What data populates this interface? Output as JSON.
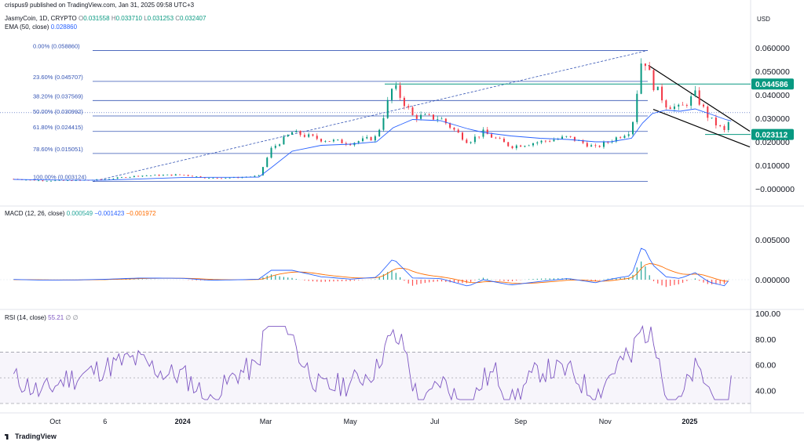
{
  "header": {
    "publisher": "crispus9 published on TradingView.com, Jan 31, 2025 09:58 UTC+3",
    "symbol": "JasmyCoin, 1D, CRYPTO",
    "open_label": "O",
    "open": "0.031558",
    "high_label": "H",
    "high": "0.033710",
    "low_label": "L",
    "low": "0.031253",
    "close_label": "C",
    "close": "0.032407",
    "ema_label": "EMA (50, close)",
    "ema_value": "0.028860",
    "currency": "USD"
  },
  "price_axis": {
    "ticks": [
      "0.060000",
      "0.050000",
      "0.040000",
      "0.030000",
      "0.020000",
      "0.010000",
      "−0.000000"
    ],
    "badges": [
      {
        "value": "0.044586",
        "color": "#089981"
      },
      {
        "value": "0.023112",
        "color": "#089981"
      }
    ]
  },
  "fib_levels": [
    {
      "label": "0.00% (0.058860)",
      "price": 0.05886
    },
    {
      "label": "23.60% (0.045707)",
      "price": 0.045707
    },
    {
      "label": "38.20% (0.037569)",
      "price": 0.037569
    },
    {
      "label": "50.00% (0.030992)",
      "price": 0.030992
    },
    {
      "label": "61.80% (0.024415)",
      "price": 0.024415
    },
    {
      "label": "78.60% (0.015051)",
      "price": 0.015051
    },
    {
      "label": "100.00% (0.003124)",
      "price": 0.003124
    }
  ],
  "macd": {
    "label": "MACD (12, 26, close)",
    "hist": "0.000549",
    "macd": "−0.001423",
    "signal": "−0.001972",
    "ticks": [
      "0.005000",
      "0.000000"
    ]
  },
  "rsi": {
    "label": "RSI (14, close)",
    "value": "55.21",
    "extra": "∅ ∅",
    "ticks": [
      "100.00",
      "80.00",
      "60.00",
      "40.00"
    ]
  },
  "x_axis": {
    "ticks": [
      {
        "label": "Oct",
        "bold": false
      },
      {
        "label": "6",
        "bold": false
      },
      {
        "label": "2024",
        "bold": true
      },
      {
        "label": "Mar",
        "bold": false
      },
      {
        "label": "May",
        "bold": false
      },
      {
        "label": "Jul",
        "bold": false
      },
      {
        "label": "Sep",
        "bold": false
      },
      {
        "label": "Nov",
        "bold": false
      },
      {
        "label": "2025",
        "bold": true
      }
    ]
  },
  "logo": "TradingView",
  "chart_data": {
    "type": "line",
    "title": "JasmyCoin, 1D, CRYPTO",
    "ylabel": "USD",
    "ylim": [
      -0.003,
      0.063
    ],
    "x": [
      "2023-09-01",
      "2023-09-20",
      "2023-10-15",
      "2023-11-05",
      "2023-12-01",
      "2024-01-01",
      "2024-01-20",
      "2024-02-10",
      "2024-02-25",
      "2024-03-05",
      "2024-03-20",
      "2024-04-10",
      "2024-05-01",
      "2024-05-20",
      "2024-06-01",
      "2024-06-15",
      "2024-07-05",
      "2024-07-25",
      "2024-08-05",
      "2024-08-25",
      "2024-09-15",
      "2024-10-05",
      "2024-10-25",
      "2024-11-05",
      "2024-11-20",
      "2024-11-28",
      "2024-12-05",
      "2024-12-15",
      "2024-12-25",
      "2025-01-05",
      "2025-01-15",
      "2025-01-27",
      "2025-01-31"
    ],
    "series": [
      {
        "name": "JasmyCoin",
        "values": [
          0.0042,
          0.0035,
          0.0035,
          0.004,
          0.0056,
          0.006,
          0.0045,
          0.0048,
          0.0055,
          0.017,
          0.024,
          0.021,
          0.0195,
          0.022,
          0.044,
          0.031,
          0.03,
          0.02,
          0.024,
          0.018,
          0.02,
          0.022,
          0.0175,
          0.0205,
          0.025,
          0.058,
          0.045,
          0.036,
          0.034,
          0.04,
          0.03,
          0.024,
          0.0324
        ]
      },
      {
        "name": "EMA (50, close)",
        "values": [
          0.004,
          0.0038,
          0.0037,
          0.0037,
          0.0042,
          0.0048,
          0.0049,
          0.0049,
          0.005,
          0.009,
          0.016,
          0.0185,
          0.019,
          0.02,
          0.026,
          0.0295,
          0.029,
          0.0255,
          0.024,
          0.0225,
          0.0215,
          0.021,
          0.02,
          0.02,
          0.0215,
          0.028,
          0.032,
          0.0335,
          0.033,
          0.034,
          0.032,
          0.0295,
          0.0289
        ]
      }
    ],
    "annotations": [
      "0.044586",
      "0.023112"
    ]
  }
}
